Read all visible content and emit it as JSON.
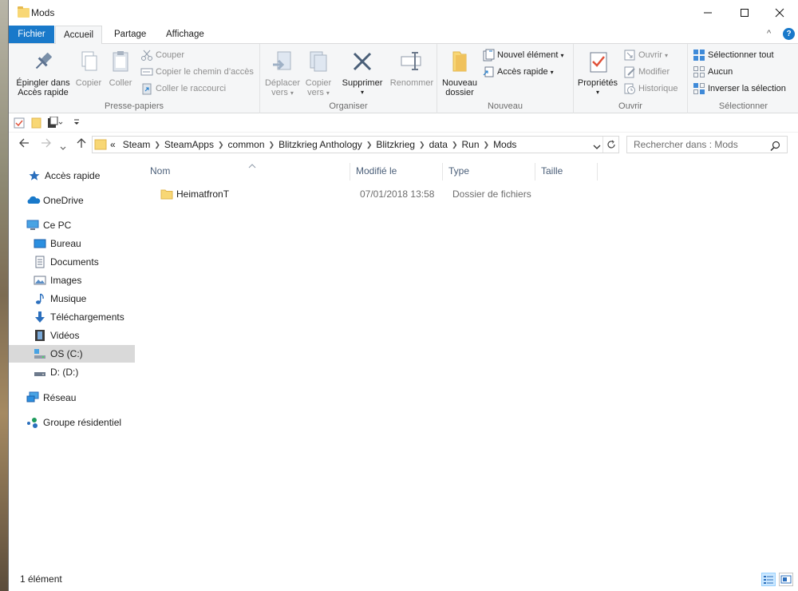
{
  "window": {
    "title": "Mods",
    "min": "—",
    "max": "☐",
    "close": "✕"
  },
  "tabs": {
    "file": "Fichier",
    "home": "Accueil",
    "share": "Partage",
    "view": "Affichage",
    "collapse": "^",
    "help": "?"
  },
  "ribbon": {
    "clipboard": {
      "label": "Presse-papiers",
      "pin": [
        "Épingler dans",
        "Accès rapide"
      ],
      "copy": "Copier",
      "paste": "Coller",
      "cut": "Couper",
      "copy_path": "Copier le chemin d’accès",
      "paste_shortcut": "Coller le raccourci"
    },
    "organize": {
      "label": "Organiser",
      "move": [
        "Déplacer",
        "vers"
      ],
      "copy_to": [
        "Copier",
        "vers"
      ],
      "delete": "Supprimer",
      "rename": "Renommer"
    },
    "new": {
      "label": "Nouveau",
      "new_folder": [
        "Nouveau",
        "dossier"
      ],
      "new_item": "Nouvel élément",
      "easy_access": "Accès rapide"
    },
    "open": {
      "label": "Ouvrir",
      "properties": "Propriétés",
      "open": "Ouvrir",
      "edit": "Modifier",
      "history": "Historique"
    },
    "select": {
      "label": "Sélectionner",
      "select_all": "Sélectionner tout",
      "select_none": "Aucun",
      "invert": "Inverser la sélection"
    }
  },
  "address": {
    "overflow": "«",
    "crumbs": [
      "Steam",
      "SteamApps",
      "common",
      "Blitzkrieg Anthology",
      "Blitzkrieg",
      "data",
      "Run",
      "Mods"
    ],
    "search_placeholder": "Rechercher dans : Mods"
  },
  "nav": {
    "quick_access": "Accès rapide",
    "onedrive": "OneDrive",
    "this_pc": "Ce PC",
    "desktop": "Bureau",
    "documents": "Documents",
    "pictures": "Images",
    "music": "Musique",
    "downloads": "Téléchargements",
    "videos": "Vidéos",
    "c_drive": "OS (C:)",
    "d_drive": "D: (D:)",
    "network": "Réseau",
    "homegroup": "Groupe résidentiel"
  },
  "columns": {
    "name": "Nom",
    "modified": "Modifié le",
    "type": "Type",
    "size": "Taille"
  },
  "files": [
    {
      "name": "HeimatfronT",
      "modified": "07/01/2018 13:58",
      "type": "Dossier de fichiers",
      "size": ""
    }
  ],
  "status": {
    "count": "1 élément"
  }
}
